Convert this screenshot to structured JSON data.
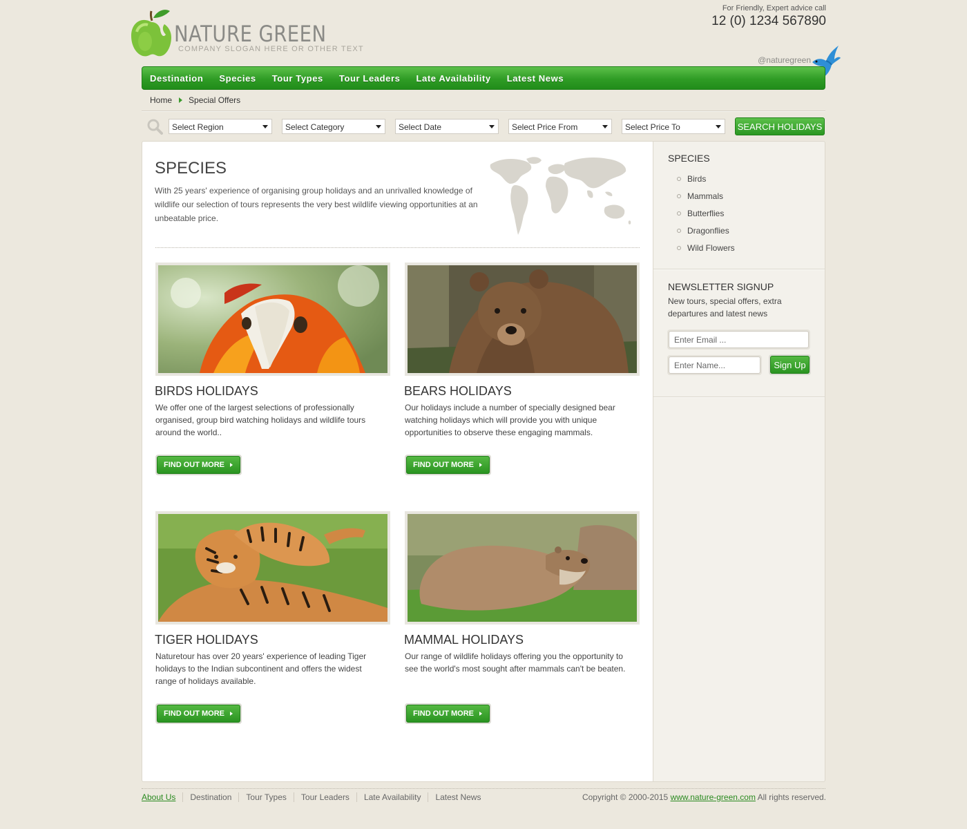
{
  "header": {
    "brand_name": "NATURE GREEN",
    "slogan": "COMPANY SLOGAN HERE OR OTHER TEXT",
    "contact_note": "For Friendly, Expert advice call",
    "phone": "12 (0) 1234 567890",
    "twitter_handle": "@naturegreen"
  },
  "nav": {
    "items": [
      "Destination",
      "Species",
      "Tour Types",
      "Tour Leaders",
      "Late Availability",
      "Latest News"
    ]
  },
  "breadcrumb": {
    "home": "Home",
    "current": "Special Offers"
  },
  "search": {
    "selects": [
      "Select Region",
      "Select Category",
      "Select Date",
      "Select Price From",
      "Select Price To"
    ],
    "button_label": "SEARCH HOLIDAYS"
  },
  "main": {
    "title": "SPECIES",
    "intro": "With 25 years' experience of organising group holidays and an unrivalled knowledge of wildlife our selection of tours represents the very best wildlife viewing opportunities at an unbeatable price.",
    "cards": [
      {
        "title": "BIRDS HOLIDAYS",
        "text": "We offer one of the largest selections of professionally organised, group bird watching holidays and wildlife tours around the world..",
        "button": "FIND OUT MORE",
        "image": "macaw-photo"
      },
      {
        "title": "BEARS HOLIDAYS",
        "text": "Our holidays include a number of specially designed bear watching holidays which will provide you with unique opportunities to observe these engaging mammals.",
        "button": "FIND OUT MORE",
        "image": "bear-photo"
      },
      {
        "title": "TIGER HOLIDAYS",
        "text": "Naturetour has over 20 years' experience of leading Tiger holidays to the Indian subcontinent and offers the widest range of holidays available.",
        "button": "FIND OUT MORE",
        "image": "tiger-photo"
      },
      {
        "title": "MAMMAL HOLIDAYS",
        "text": "Our range of wildlife holidays offering you the opportunity to see the world's most sought after mammals can't be beaten.",
        "button": "FIND OUT MORE",
        "image": "otter-photo"
      }
    ]
  },
  "sidebar": {
    "species_heading": "SPECIES",
    "species_items": [
      "Birds",
      "Mammals",
      "Butterflies",
      "Dragonflies",
      "Wild Flowers"
    ],
    "newsletter": {
      "heading": "NEWSLETTER SIGNUP",
      "text": "New tours, special offers, extra departures and latest news",
      "email_placeholder": "Enter Email ...",
      "name_placeholder": "Enter Name...",
      "button": "Sign Up"
    }
  },
  "footer": {
    "links": [
      "About Us",
      "Destination",
      "Tour Types",
      "Tour Leaders",
      "Late Availability",
      "Latest News"
    ],
    "copyright_prefix": "Copyright © 2000-2015",
    "site_link": "www.nature-green.com",
    "copyright_suffix": " All rights reserved."
  },
  "colors": {
    "accent_green": "#2f9c25",
    "background": "#ece8de",
    "link_green": "#2a8a20"
  }
}
